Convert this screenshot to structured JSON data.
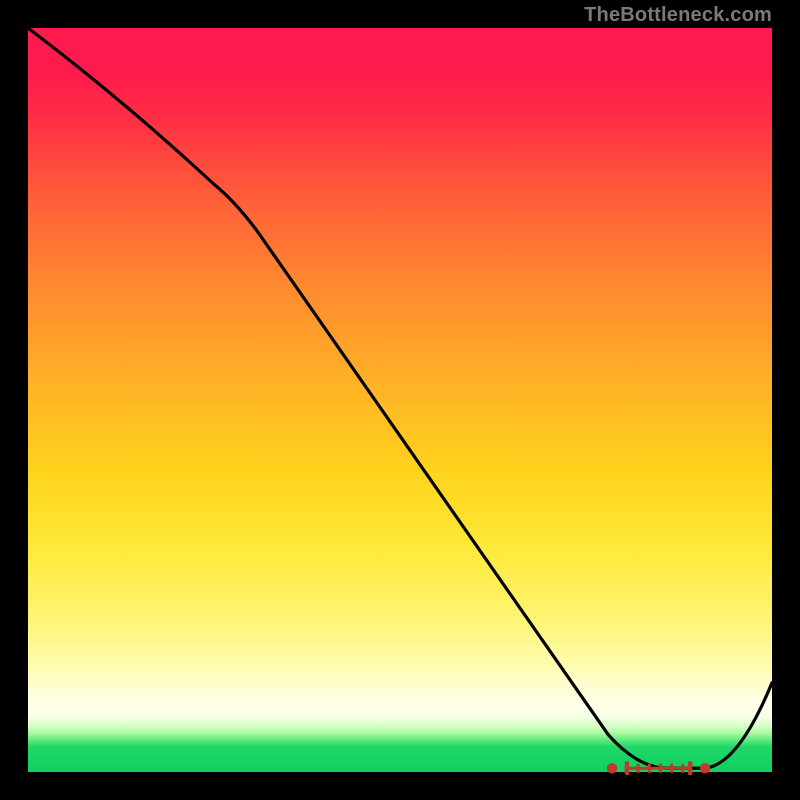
{
  "watermark": "TheBottleneck.com",
  "chart_data": {
    "type": "line",
    "title": "",
    "xlabel": "",
    "ylabel": "",
    "xlim": [
      0,
      100
    ],
    "ylim": [
      0,
      100
    ],
    "grid": false,
    "legend": false,
    "series": [
      {
        "name": "curve",
        "x": [
          0,
          25,
          78,
          86,
          91,
          100
        ],
        "values": [
          100,
          79,
          5,
          0.5,
          0.5,
          12
        ]
      }
    ],
    "markers": {
      "y": 0.5,
      "left_dot_x": 78.5,
      "right_dot_x": 91,
      "cap_left_x": 80.5,
      "cap_right_x": 89,
      "ticks_x": [
        82,
        83.5,
        85,
        86.5,
        88
      ]
    },
    "background_gradient": {
      "stops": [
        {
          "pos": 0,
          "color": "#ff1a4d"
        },
        {
          "pos": 0.22,
          "color": "#ff5a3a"
        },
        {
          "pos": 0.48,
          "color": "#ffb326"
        },
        {
          "pos": 0.7,
          "color": "#ffe93a"
        },
        {
          "pos": 0.9,
          "color": "#ffffe0"
        },
        {
          "pos": 0.96,
          "color": "#5ae87a"
        },
        {
          "pos": 1.0,
          "color": "#0fcf63"
        }
      ]
    }
  }
}
